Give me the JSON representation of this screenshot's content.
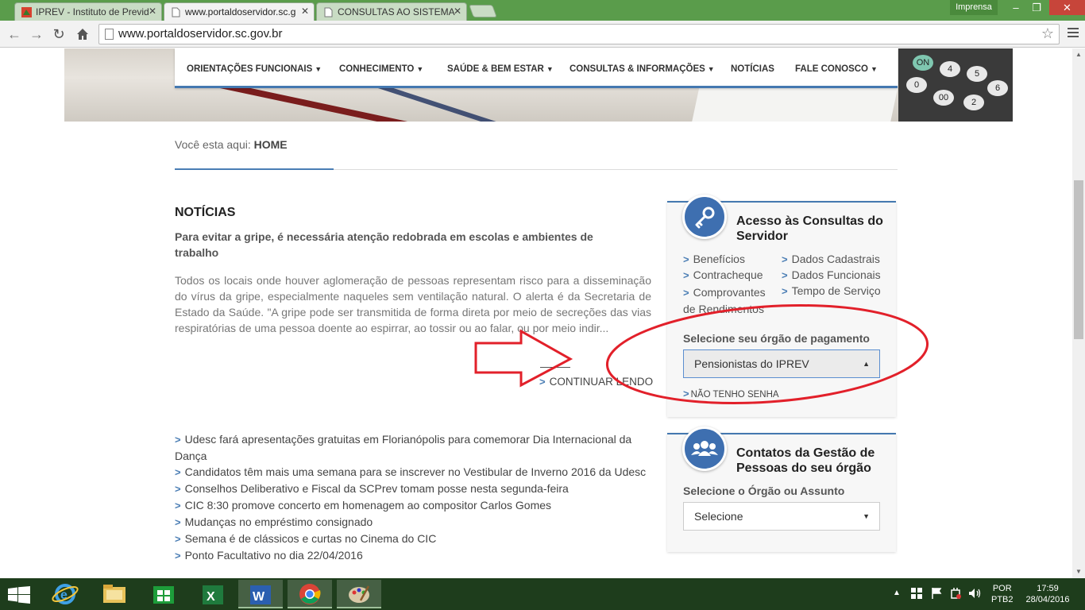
{
  "browser": {
    "tabs": [
      {
        "label": "IPREV - Instituto de Previd"
      },
      {
        "label": "www.portaldoservidor.sc.g"
      },
      {
        "label": "CONSULTAS AO SISTEMA"
      }
    ],
    "incognito_label": "Imprensa",
    "url": "www.portaldoservidor.sc.gov.br"
  },
  "nav": {
    "items": [
      "ORIENTAÇÕES FUNCIONAIS",
      "CONHECIMENTO",
      "SAÚDE & BEM ESTAR",
      "CONSULTAS & INFORMAÇÕES",
      "NOTÍCIAS",
      "FALE CONOSCO"
    ]
  },
  "breadcrumb": {
    "prefix": "Você esta aqui:",
    "current": "HOME"
  },
  "news": {
    "section_title": "NOTÍCIAS",
    "headline": "Para evitar a gripe, é necessária atenção redobrada em escolas e ambientes de trabalho",
    "body": "Todos os locais onde houver aglomeração de pessoas representam risco para a disseminação do vírus da gripe, especialmente naqueles sem ventilação natural. O alerta é da Secretaria de Estado da Saúde. \"A gripe pode ser transmitida de forma direta por meio de secreções das vias respiratórias de uma pessoa doente ao espirrar, ao tossir ou ao falar, ou por meio indir...",
    "continue_label": "CONTINUAR LENDO",
    "list": [
      "Udesc fará apresentações gratuitas em Florianópolis para comemorar Dia Internacional da Dança",
      "Candidatos têm mais uma semana para se inscrever no Vestibular de Inverno 2016 da Udesc",
      "Conselhos Deliberativo e Fiscal da SCPrev tomam posse nesta segunda-feira",
      "CIC 8:30 promove concerto em homenagem ao compositor Carlos Gomes",
      "Mudanças no empréstimo consignado",
      "Semana é de clássicos e curtas no Cinema do CIC",
      "Ponto Facultativo no dia 22/04/2016"
    ]
  },
  "access_box": {
    "title": "Acesso às Consultas do Servidor",
    "links": {
      "beneficios": "Benefícios",
      "dados_cadastrais": "Dados Cadastrais",
      "contracheque": "Contracheque",
      "dados_funcionais": "Dados Funcionais",
      "comprovantes": "Comprovantes de Rendimentos",
      "tempo_servico": "Tempo de Serviço"
    },
    "select_label": "Selecione seu órgão de pagamento",
    "selected": "Pensionistas do IPREV",
    "no_password": "NÃO TENHO SENHA"
  },
  "contacts_box": {
    "title": "Contatos da Gestão de Pessoas do seu órgão",
    "select_label": "Selecione o Órgão ou Assunto",
    "selected": "Selecione"
  },
  "taskbar": {
    "language": "POR",
    "layout": "PTB2",
    "time": "17:59",
    "date": "28/04/2016"
  },
  "colors": {
    "accent": "#4478b0",
    "annotation_red": "#e2202a",
    "tabstrip_green": "#5a9c4b",
    "taskbar": "#1e3d1c"
  }
}
